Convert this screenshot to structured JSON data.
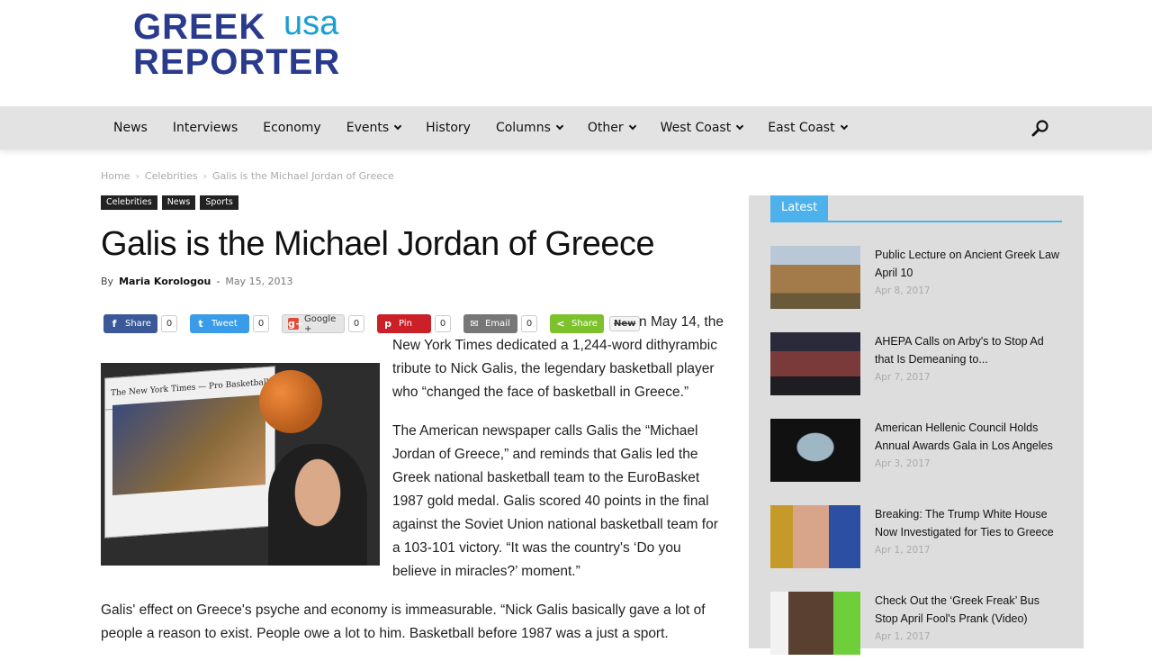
{
  "site": {
    "logo_line1": "GREEK",
    "logo_usa": "usa",
    "logo_line2": "REPORTER",
    "brand_color": "#2a3a8c",
    "accent_color": "#1a9fd0"
  },
  "nav": {
    "items": [
      {
        "label": "News",
        "dropdown": false
      },
      {
        "label": "Interviews",
        "dropdown": false
      },
      {
        "label": "Economy",
        "dropdown": false
      },
      {
        "label": "Events",
        "dropdown": true
      },
      {
        "label": "History",
        "dropdown": false
      },
      {
        "label": "Columns",
        "dropdown": true
      },
      {
        "label": "Other",
        "dropdown": true
      },
      {
        "label": "West Coast",
        "dropdown": true
      },
      {
        "label": "East Coast",
        "dropdown": true
      }
    ],
    "search_icon": "search-icon"
  },
  "breadcrumb": {
    "home": "Home",
    "category": "Celebrities",
    "current": "Galis is the Michael Jordan of Greece",
    "separator": "›"
  },
  "tags": [
    "Celebrities",
    "News",
    "Sports"
  ],
  "article": {
    "title": "Galis is the Michael Jordan of Greece",
    "by": "By",
    "author": "Maria Korologou",
    "dash": "-",
    "date": "May 15, 2013",
    "share": [
      {
        "label": "Share",
        "count": "0",
        "icon": "f"
      },
      {
        "label": "Tweet",
        "count": "0",
        "icon": "t"
      },
      {
        "label": "Google +",
        "count": "0",
        "icon": "g+"
      },
      {
        "label": "Pin",
        "count": "0",
        "icon": "p"
      },
      {
        "label": "Email",
        "count": "0",
        "icon": "✉"
      },
      {
        "label": "Share",
        "count": "",
        "icon": "<"
      }
    ],
    "new_label": "New",
    "image_caption_text": "Pro Basketball",
    "image_masthead": "The New York Times",
    "p1": "On May 14, the New York Times dedicated a 1,244-word dithyrambic tribute to Nick Galis, the legendary basketball player who “changed the face of basketball in Greece.”",
    "p2": "The American newspaper calls Galis the “Michael Jordan of Greece,” and reminds that Galis led the Greek national basketball team to the EuroBasket 1987 gold medal. Galis scored 40 points in the final against the Soviet Union national basketball team for a 103-101 victory. “It was the country's ‘Do you believe in miracles?’ moment.”",
    "p3": "Galis' effect on Greece's psyche and economy is immeasurable. “Nick Galis basically gave a lot of people a reason to exist. People owe a lot to him. Basketball before 1987 was a just a sport."
  },
  "sidebar": {
    "heading": "Latest",
    "posts": [
      {
        "title": "Public Lecture on Ancient Greek Law April 10",
        "date": "Apr 8, 2017"
      },
      {
        "title": "AHEPA Calls on Arby's to Stop Ad that Is Demeaning to...",
        "date": "Apr 7, 2017"
      },
      {
        "title": "American Hellenic Council Holds Annual Awards Gala in Los Angeles",
        "date": "Apr 3, 2017"
      },
      {
        "title": "Breaking: The Trump White House Now Investigated for Ties to Greece",
        "date": "Apr 1, 2017"
      },
      {
        "title": "Check Out the ‘Greek Freak’ Bus Stop April Fool's Prank (Video)",
        "date": "Apr 1, 2017"
      }
    ]
  }
}
